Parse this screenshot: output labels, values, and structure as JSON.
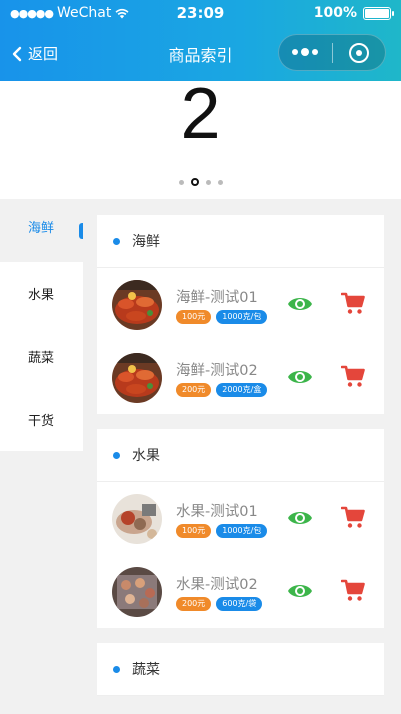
{
  "status_bar": {
    "signal": "●●●●●",
    "carrier": "WeChat",
    "time": "23:09",
    "battery": "100%"
  },
  "nav": {
    "back_label": "返回",
    "title": "商品索引"
  },
  "banner": {
    "number": "2",
    "dot_count": 4,
    "active_dot": 1
  },
  "sidebar": {
    "items": [
      {
        "label": "海鲜",
        "active": true
      },
      {
        "label": "水果",
        "active": false
      },
      {
        "label": "蔬菜",
        "active": false
      },
      {
        "label": "干货",
        "active": false
      }
    ]
  },
  "sections": [
    {
      "title": "海鲜",
      "products": [
        {
          "name": "海鲜-测试01",
          "price": "100元",
          "spec": "1000克/包",
          "image": "seafood-crayfish"
        },
        {
          "name": "海鲜-测试02",
          "price": "200元",
          "spec": "2000克/盒",
          "image": "seafood-crayfish"
        }
      ]
    },
    {
      "title": "水果",
      "products": [
        {
          "name": "水果-测试01",
          "price": "100元",
          "spec": "1000克/包",
          "image": "fruit-plate"
        },
        {
          "name": "水果-测试02",
          "price": "200元",
          "spec": "600克/袋",
          "image": "fruit-tray"
        }
      ]
    },
    {
      "title": "蔬菜",
      "products": []
    }
  ],
  "icons": {
    "view": "eye-icon",
    "cart": "cart-icon"
  },
  "colors": {
    "accent": "#1a8be8",
    "price_tag": "#f08a2a",
    "eye": "#3cb54a",
    "cart": "#e4463b"
  }
}
